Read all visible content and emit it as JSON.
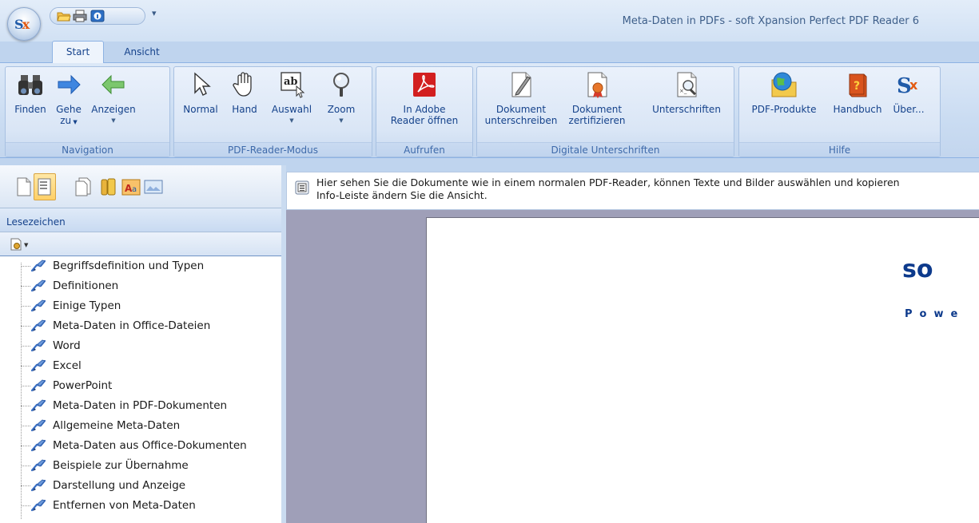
{
  "window": {
    "title": "Meta-Daten in PDFs - soft Xpansion Perfect PDF Reader 6",
    "qat_more": "▾"
  },
  "tabs": [
    {
      "label": "Start",
      "selected": true
    },
    {
      "label": "Ansicht",
      "selected": false
    }
  ],
  "ribbon": {
    "groups": [
      {
        "label": "Navigation",
        "buttons": [
          {
            "label": "Finden",
            "icon": "binoculars-icon"
          },
          {
            "label": "Gehe",
            "label2": "zu",
            "dropdown": true,
            "icon": "arrow-right-icon"
          },
          {
            "label": "Anzeigen",
            "dropdown": true,
            "icon": "arrow-left-icon"
          }
        ]
      },
      {
        "label": "PDF-Reader-Modus",
        "buttons": [
          {
            "label": "Normal",
            "icon": "cursor-icon"
          },
          {
            "label": "Hand",
            "icon": "hand-icon"
          },
          {
            "label": "Auswahl",
            "dropdown": true,
            "icon": "text-select-icon"
          },
          {
            "label": "Zoom",
            "dropdown": true,
            "icon": "magnifier-icon"
          }
        ]
      },
      {
        "label": "Aufrufen",
        "buttons": [
          {
            "label": "In Adobe",
            "label2": "Reader öffnen",
            "icon": "adobe-reader-icon"
          }
        ]
      },
      {
        "label": "Digitale Unterschriften",
        "buttons": [
          {
            "label": "Dokument",
            "label2": "unterschreiben",
            "icon": "sign-document-icon"
          },
          {
            "label": "Dokument",
            "label2": "zertifizieren",
            "icon": "certify-document-icon"
          },
          {
            "label": "Unterschriften",
            "icon": "signatures-icon"
          }
        ]
      },
      {
        "label": "Hilfe",
        "buttons": [
          {
            "label": "PDF-Produkte",
            "icon": "globe-folder-icon"
          },
          {
            "label": "Handbuch",
            "icon": "book-icon"
          },
          {
            "label": "Über...",
            "icon": "sx-logo-icon"
          }
        ]
      }
    ]
  },
  "left_panel": {
    "header": "Lesezeichen",
    "bookmarks": [
      "Begriffsdefinition und Typen",
      "Definitionen",
      "Einige Typen",
      "Meta-Daten in Office-Dateien",
      "Word",
      "Excel",
      "PowerPoint",
      "Meta-Daten in PDF-Dokumenten",
      "Allgemeine Meta-Daten",
      "Meta-Daten aus Office-Dokumenten",
      "Beispiele zur Übernahme",
      "Darstellung und Anzeige",
      "Entfernen von Meta-Daten"
    ]
  },
  "infobar": {
    "line1": "Hier sehen Sie die Dokumente wie in einem normalen PDF-Reader, können Texte und Bilder auswählen und kopieren",
    "line2": "Info-Leiste ändern Sie die Ansicht."
  },
  "document": {
    "logo_text": "so",
    "subtitle_text": "Powe"
  },
  "colors": {
    "ribbon_text": "#15428b",
    "doc_background": "#9f9fb8",
    "logo_blue": "#0d3a8c"
  }
}
